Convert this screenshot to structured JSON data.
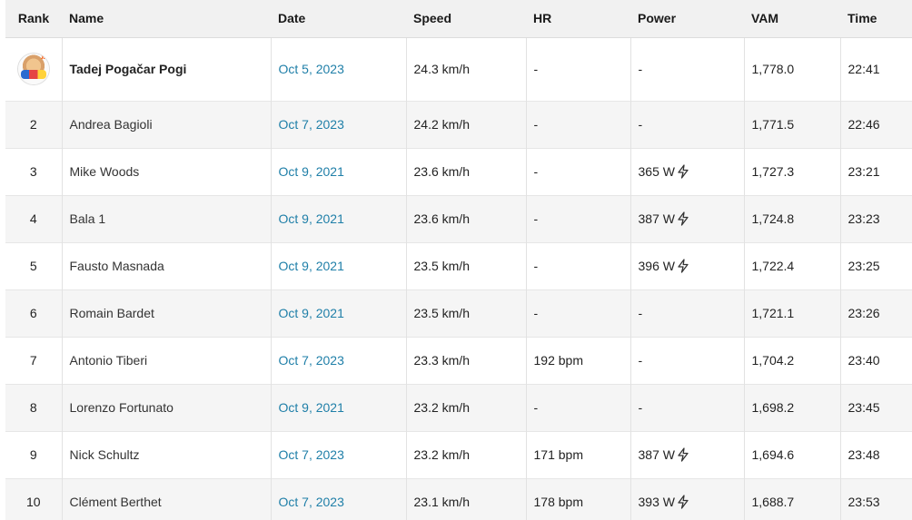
{
  "headers": {
    "rank": "Rank",
    "name": "Name",
    "date": "Date",
    "speed": "Speed",
    "hr": "HR",
    "power": "Power",
    "vam": "VAM",
    "time": "Time"
  },
  "rows": [
    {
      "rank": "",
      "name": "Tadej Pogačar Pogi",
      "date": "Oct 5, 2023",
      "speed": "24.3 km/h",
      "hr": "-",
      "power": "-",
      "vam": "1,778.0",
      "time": "22:41"
    },
    {
      "rank": "2",
      "name": "Andrea Bagioli",
      "date": "Oct 7, 2023",
      "speed": "24.2 km/h",
      "hr": "-",
      "power": "-",
      "vam": "1,771.5",
      "time": "22:46"
    },
    {
      "rank": "3",
      "name": "Mike Woods",
      "date": "Oct 9, 2021",
      "speed": "23.6 km/h",
      "hr": "-",
      "power": "365 W",
      "vam": "1,727.3",
      "time": "23:21"
    },
    {
      "rank": "4",
      "name": "Bala 1",
      "date": "Oct 9, 2021",
      "speed": "23.6 km/h",
      "hr": "-",
      "power": "387 W",
      "vam": "1,724.8",
      "time": "23:23"
    },
    {
      "rank": "5",
      "name": "Fausto Masnada",
      "date": "Oct 9, 2021",
      "speed": "23.5 km/h",
      "hr": "-",
      "power": "396 W",
      "vam": "1,722.4",
      "time": "23:25"
    },
    {
      "rank": "6",
      "name": "Romain Bardet",
      "date": "Oct 9, 2021",
      "speed": "23.5 km/h",
      "hr": "-",
      "power": "-",
      "vam": "1,721.1",
      "time": "23:26"
    },
    {
      "rank": "7",
      "name": "Antonio Tiberi",
      "date": "Oct 7, 2023",
      "speed": "23.3 km/h",
      "hr": "192 bpm",
      "power": "-",
      "vam": "1,704.2",
      "time": "23:40"
    },
    {
      "rank": "8",
      "name": "Lorenzo Fortunato",
      "date": "Oct 9, 2021",
      "speed": "23.2 km/h",
      "hr": "-",
      "power": "-",
      "vam": "1,698.2",
      "time": "23:45"
    },
    {
      "rank": "9",
      "name": "Nick Schultz",
      "date": "Oct 7, 2023",
      "speed": "23.2 km/h",
      "hr": "171 bpm",
      "power": "387 W",
      "vam": "1,694.6",
      "time": "23:48"
    },
    {
      "rank": "10",
      "name": "Clément Berthet",
      "date": "Oct 7, 2023",
      "speed": "23.1 km/h",
      "hr": "178 bpm",
      "power": "393 W",
      "vam": "1,688.7",
      "time": "23:53"
    }
  ],
  "icons": {
    "first_rank": "crown-avatar-icon",
    "power_estimated": "lightning-bolt-icon"
  },
  "colors": {
    "date_link": "#1f7fa8",
    "header_bg": "#f1f1f1",
    "row_alt_bg": "#f5f5f5"
  }
}
